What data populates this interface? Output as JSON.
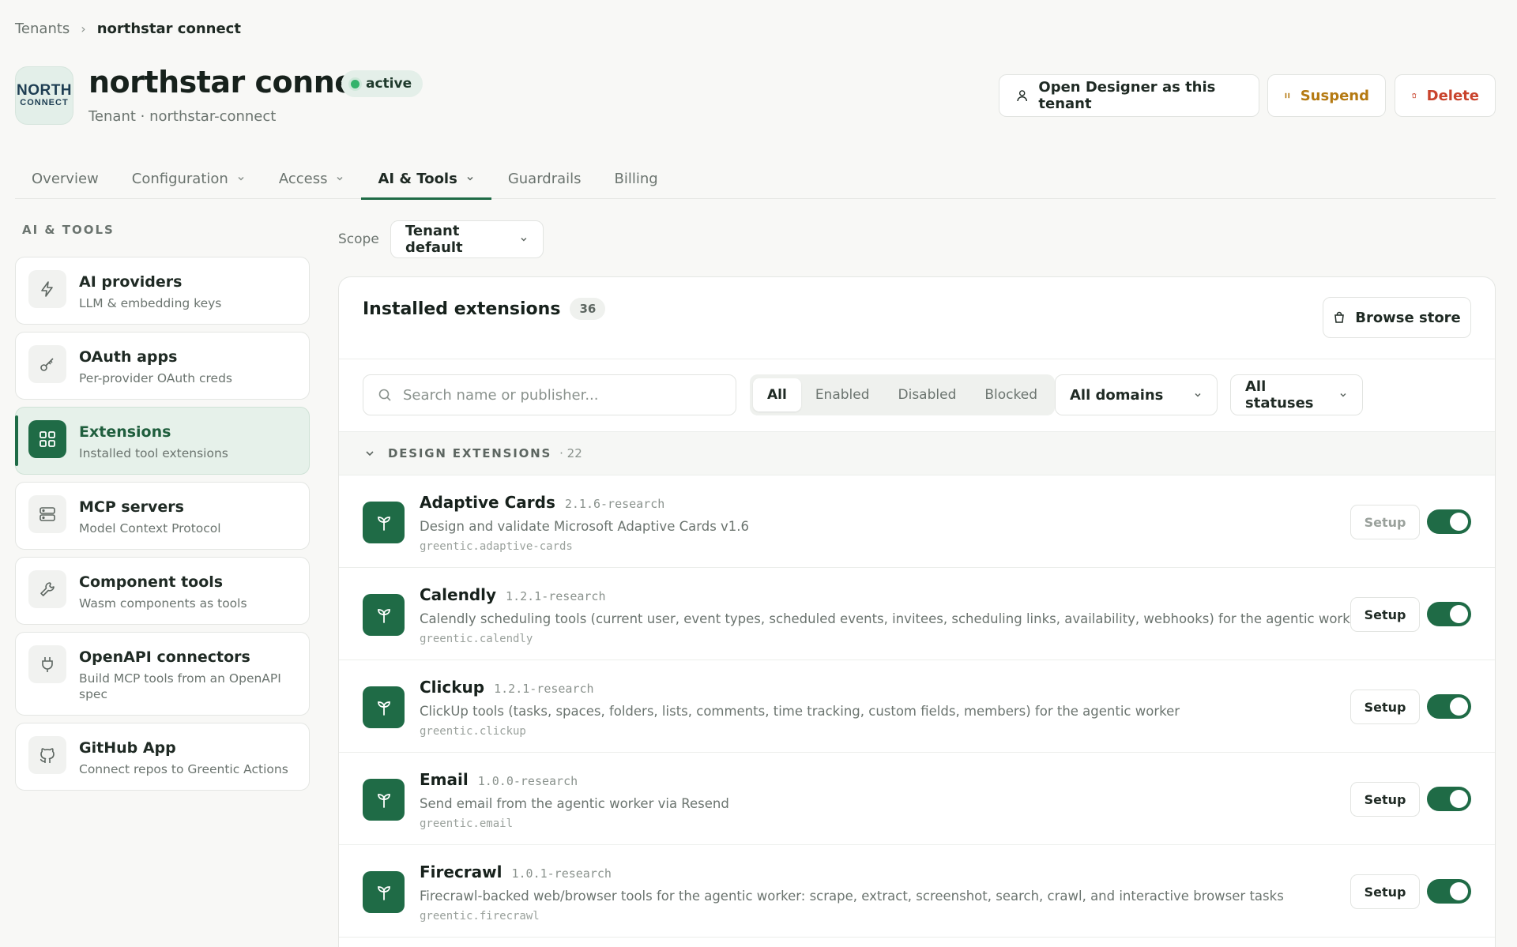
{
  "breadcrumb": {
    "root": "Tenants",
    "current": "northstar connect"
  },
  "tenant": {
    "logo_line1": "NORTH",
    "logo_line2": "CONNECT",
    "name": "northstar connect",
    "status": "active",
    "subtitle": "Tenant · northstar-connect"
  },
  "header_actions": {
    "designer": "Open Designer as this tenant",
    "suspend": "Suspend",
    "delete": "Delete"
  },
  "tabs": [
    {
      "label": "Overview"
    },
    {
      "label": "Configuration"
    },
    {
      "label": "Access"
    },
    {
      "label": "AI & Tools"
    },
    {
      "label": "Guardrails"
    },
    {
      "label": "Billing"
    }
  ],
  "sidebar": {
    "heading": "AI & TOOLS",
    "items": [
      {
        "label": "AI providers",
        "desc": "LLM & embedding keys",
        "icon": "bolt-icon"
      },
      {
        "label": "OAuth apps",
        "desc": "Per-provider OAuth creds",
        "icon": "key-icon"
      },
      {
        "label": "Extensions",
        "desc": "Installed tool extensions",
        "icon": "grid-icon"
      },
      {
        "label": "MCP servers",
        "desc": "Model Context Protocol",
        "icon": "server-icon"
      },
      {
        "label": "Component tools",
        "desc": "Wasm components as tools",
        "icon": "wrench-icon"
      },
      {
        "label": "OpenAPI connectors",
        "desc": "Build MCP tools from an OpenAPI spec",
        "icon": "plug-icon"
      },
      {
        "label": "GitHub App",
        "desc": "Connect repos to Greentic Actions",
        "icon": "github-icon"
      }
    ]
  },
  "scope": {
    "label": "Scope",
    "value": "Tenant default"
  },
  "extensions_panel": {
    "title": "Installed extensions",
    "count": "36",
    "browse_label": "Browse store",
    "search_placeholder": "Search name or publisher...",
    "filters": [
      "All",
      "Enabled",
      "Disabled",
      "Blocked"
    ],
    "domain_filter": "All domains",
    "status_filter": "All statuses",
    "group": {
      "label": "DESIGN EXTENSIONS",
      "count": "· 22"
    },
    "items": [
      {
        "name": "Adaptive Cards",
        "version": "2.1.6-research",
        "desc": "Design and validate Microsoft Adaptive Cards v1.6",
        "id": "greentic.adaptive-cards",
        "setup": "Setup",
        "enabled": true
      },
      {
        "name": "Calendly",
        "version": "1.2.1-research",
        "desc": "Calendly scheduling tools (current user, event types, scheduled events, invitees, scheduling links, availability, webhooks) for the agentic worker",
        "id": "greentic.calendly",
        "setup": "Setup",
        "enabled": true
      },
      {
        "name": "Clickup",
        "version": "1.2.1-research",
        "desc": "ClickUp tools (tasks, spaces, folders, lists, comments, time tracking, custom fields, members) for the agentic worker",
        "id": "greentic.clickup",
        "setup": "Setup",
        "enabled": true
      },
      {
        "name": "Email",
        "version": "1.0.0-research",
        "desc": "Send email from the agentic worker via Resend",
        "id": "greentic.email",
        "setup": "Setup",
        "enabled": true
      },
      {
        "name": "Firecrawl",
        "version": "1.0.1-research",
        "desc": "Firecrawl-backed web/browser tools for the agentic worker: scrape, extract, screenshot, search, crawl, and interactive browser tasks",
        "id": "greentic.firecrawl",
        "setup": "Setup",
        "enabled": true
      }
    ]
  },
  "colors": {
    "accent": "#1f6b46",
    "status_dot": "#34b36b",
    "suspend": "#b57a12",
    "delete": "#c9432c"
  }
}
